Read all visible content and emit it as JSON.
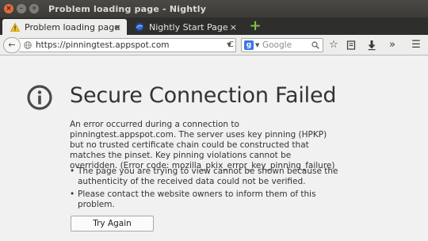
{
  "window": {
    "title": "Problem loading page - Nightly"
  },
  "tabs": [
    {
      "label": "Problem loading page",
      "close": "×"
    },
    {
      "label": "Nightly Start Page",
      "close": "×"
    }
  ],
  "navbar": {
    "back": "←",
    "url": "https://pinningtest.appspot.com",
    "reload": "C",
    "search_placeholder": "Google",
    "overflow": "»",
    "menu": "☰"
  },
  "error": {
    "title": "Secure Connection Failed",
    "description": "An error occurred during a connection to pinningtest.appspot.com. The server uses key pinning (HPKP) but no trusted certificate chain could be constructed that matches the pinset. Key pinning violations cannot be overridden. (Error code: mozilla_pkix_error_key_pinning_failure)",
    "bullets": [
      "The page you are trying to view cannot be shown because the authenticity of the received data could not be verified.",
      "Please contact the website owners to inform them of this problem."
    ],
    "button": "Try Again"
  }
}
